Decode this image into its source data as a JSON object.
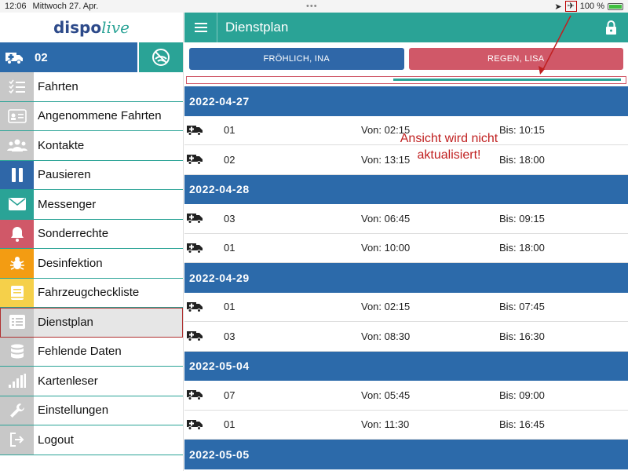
{
  "status": {
    "time": "12:06",
    "date": "Mittwoch 27. Apr.",
    "battery": "100 %"
  },
  "logo": {
    "part1": "dispo",
    "part2": "live"
  },
  "vehicle": {
    "number": "02"
  },
  "menu": [
    {
      "label": "Fahrten",
      "icon": "checklist-icon",
      "color": "#c8c8c8"
    },
    {
      "label": "Angenommene Fahrten",
      "icon": "id-card-icon",
      "color": "#c8c8c8"
    },
    {
      "label": "Kontakte",
      "icon": "people-icon",
      "color": "#c8c8c8"
    },
    {
      "label": "Pausieren",
      "icon": "pause-icon",
      "color": "#2f67a8"
    },
    {
      "label": "Messenger",
      "icon": "envelope-icon",
      "color": "#2aa396"
    },
    {
      "label": "Sonderrechte",
      "icon": "bell-icon",
      "color": "#d05868"
    },
    {
      "label": "Desinfektion",
      "icon": "bug-icon",
      "color": "#f39c12"
    },
    {
      "label": "Fahrzeugchecklistе",
      "icon": "book-icon",
      "color": "#f5d04a"
    },
    {
      "label": "Dienstplan",
      "icon": "list-icon",
      "color": "#c8c8c8"
    },
    {
      "label": "Fehlende Daten",
      "icon": "database-icon",
      "color": "#c8c8c8"
    },
    {
      "label": "Kartenleser",
      "icon": "signal-bars-icon",
      "color": "#c8c8c8"
    },
    {
      "label": "Einstellungen",
      "icon": "wrench-icon",
      "color": "#c8c8c8"
    },
    {
      "label": "Logout",
      "icon": "logout-icon",
      "color": "#c8c8c8"
    }
  ],
  "header": {
    "title": "Dienstplan"
  },
  "persons": [
    {
      "name": "FRÖHLICH, INA"
    },
    {
      "name": "REGEN, LISA"
    }
  ],
  "progress": {
    "start": 0.47,
    "end": 0.99
  },
  "schedule": [
    {
      "date": "2022-04-27",
      "shifts": [
        {
          "vehicle": "01",
          "von": "Von: 02:15",
          "bis": "Bis: 10:15"
        },
        {
          "vehicle": "02",
          "von": "Von: 13:15",
          "bis": "Bis: 18:00"
        }
      ]
    },
    {
      "date": "2022-04-28",
      "shifts": [
        {
          "vehicle": "03",
          "von": "Von: 06:45",
          "bis": "Bis: 09:15"
        },
        {
          "vehicle": "01",
          "von": "Von: 10:00",
          "bis": "Bis: 18:00"
        }
      ]
    },
    {
      "date": "2022-04-29",
      "shifts": [
        {
          "vehicle": "01",
          "von": "Von: 02:15",
          "bis": "Bis: 07:45"
        },
        {
          "vehicle": "03",
          "von": "Von: 08:30",
          "bis": "Bis: 16:30"
        }
      ]
    },
    {
      "date": "2022-05-04",
      "shifts": [
        {
          "vehicle": "07",
          "von": "Von: 05:45",
          "bis": "Bis: 09:00"
        },
        {
          "vehicle": "01",
          "von": "Von: 11:30",
          "bis": "Bis: 16:45"
        }
      ]
    },
    {
      "date": "2022-05-05",
      "shifts": []
    }
  ],
  "annotation": {
    "line1": "Ansicht wird nicht",
    "line2": "aktualisiert!"
  }
}
